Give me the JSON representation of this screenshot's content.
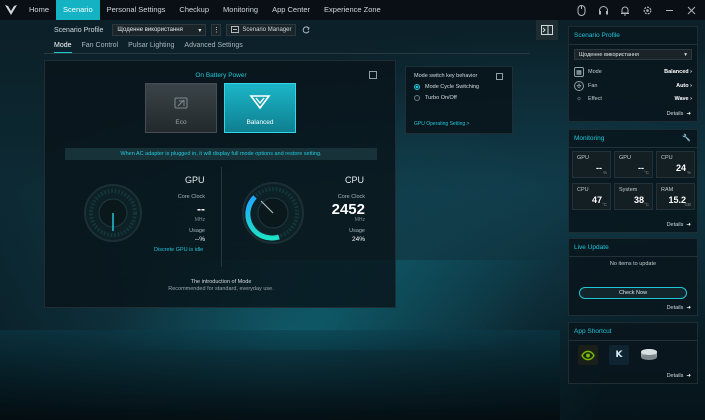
{
  "nav": {
    "items": [
      "Home",
      "Scenario",
      "Personal Settings",
      "Checkup",
      "Monitoring",
      "App Center",
      "Experience Zone"
    ],
    "active_index": 1
  },
  "header": {
    "profile_label": "Scenario Profile",
    "profile_value": "Щоденне використання",
    "manager_label": "Scenario Manager"
  },
  "tabs": [
    "Mode",
    "Fan Control",
    "Pulsar Lighting",
    "Advanced Settings"
  ],
  "mode": {
    "power_title": "On Battery Power",
    "eco_label": "Eco",
    "balanced_label": "Balanced",
    "notice": "When AC adapter is plugged in, it will display full mode options and restore setting.",
    "gpu": {
      "title": "GPU",
      "clock_label": "Core Clock",
      "clock_value": "--",
      "clock_unit": "MHz",
      "usage_label": "Usage",
      "usage_value": "--%",
      "usage_fraction": 0,
      "link": "Discrete GPU is idle"
    },
    "cpu": {
      "title": "CPU",
      "clock_label": "Core Clock",
      "clock_value": "2452",
      "clock_unit": "MHz",
      "usage_label": "Usage",
      "usage_value": "24%",
      "usage_fraction": 0.24
    },
    "intro_title": "The introduction of Mode",
    "intro_text": "Recommended for standard, everyday use."
  },
  "switch_panel": {
    "title": "Mode switch key behavior",
    "option1": "Mode Cycle Switching",
    "option2": "Turbo On/Off",
    "link": "GPU Operating Setting >"
  },
  "sidebar": {
    "scenario": {
      "title": "Scenario Profile",
      "value": "Щоденне використання",
      "mode_label": "Mode",
      "mode_value": "Balanced",
      "fan_label": "Fan",
      "fan_value": "Auto",
      "effect_label": "Effect",
      "effect_value": "Wave",
      "details": "Details"
    },
    "monitoring": {
      "title": "Monitoring",
      "items": [
        {
          "label": "GPU",
          "value": "--",
          "unit": "%"
        },
        {
          "label": "GPU",
          "value": "--",
          "unit": "°C"
        },
        {
          "label": "CPU",
          "value": "24",
          "unit": "%"
        },
        {
          "label": "CPU",
          "value": "47",
          "unit": "°C"
        },
        {
          "label": "System",
          "value": "38",
          "unit": "°C"
        },
        {
          "label": "RAM",
          "value": "15.2",
          "unit": "GB"
        }
      ],
      "details": "Details"
    },
    "live_update": {
      "title": "Live Update",
      "empty": "No items to update",
      "button": "Check Now",
      "details": "Details"
    },
    "app_shortcut": {
      "title": "App Shortcut",
      "apps": [
        "nvidia-app-icon",
        "k-app-icon",
        "disk-app-icon"
      ],
      "details": "Details"
    }
  },
  "colors": {
    "accent": "#1fc6d8",
    "active_nav": "#14b3c4"
  }
}
